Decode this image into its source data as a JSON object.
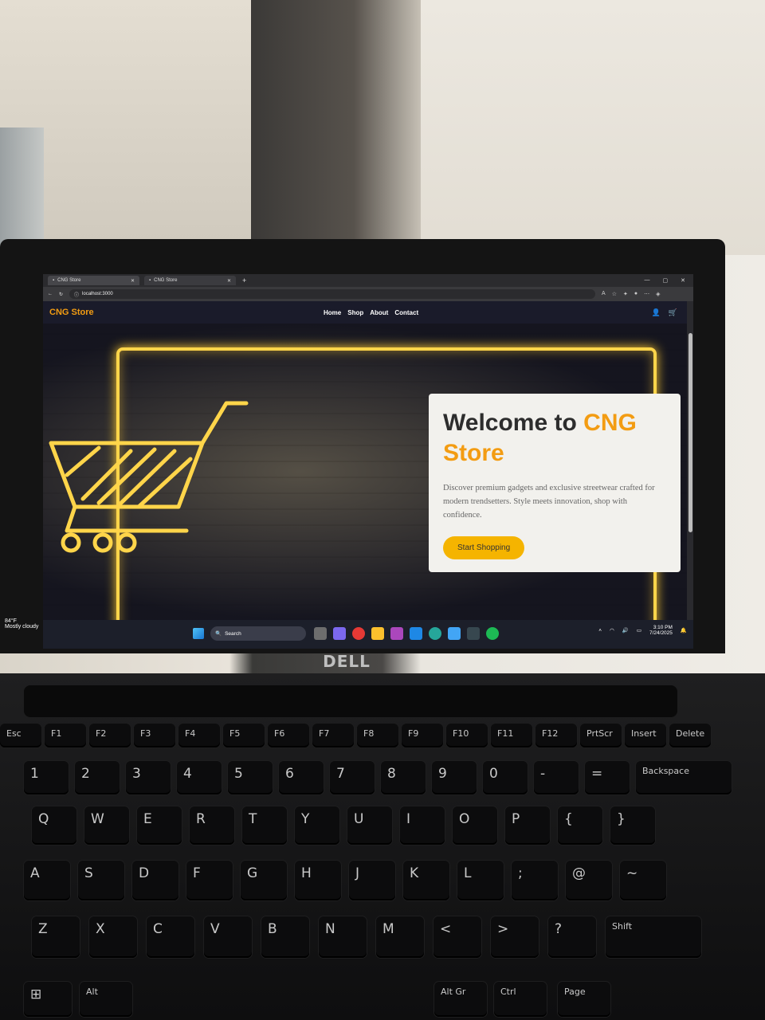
{
  "browser": {
    "tabs": [
      {
        "label": "CNG Store",
        "close": "✕"
      },
      {
        "label": "CNG Store",
        "close": "✕"
      }
    ],
    "new_tab": "+",
    "window_controls": [
      "—",
      "▢",
      "✕"
    ],
    "url": "localhost:3000"
  },
  "site": {
    "brand": "CNG Store",
    "nav": [
      "Home",
      "Shop",
      "About",
      "Contact"
    ],
    "hero": {
      "title_part1": "Welcome to ",
      "title_accent": "CNG",
      "title_part2": "Store",
      "description": "Discover premium gadgets and exclusive streetwear crafted for modern trendsetters. Style meets innovation, shop with confidence.",
      "cta": "Start Shopping"
    },
    "accent_color": "#f39c12",
    "button_color": "#f5b400"
  },
  "taskbar": {
    "weather_temp": "84°F",
    "weather_desc": "Mostly cloudy",
    "search_placeholder": "Search",
    "time": "3:10 PM",
    "date": "7/24/2025"
  },
  "laptop": {
    "brand": "DELL",
    "keys_f": [
      "Esc",
      "F1",
      "F2",
      "F3",
      "F4",
      "F5",
      "F6",
      "F7",
      "F8",
      "F9",
      "F10",
      "F11",
      "F12",
      "PrtScr",
      "Insert",
      "Delete"
    ],
    "keys_num": [
      "1",
      "2",
      "3",
      "4",
      "5",
      "6",
      "7",
      "8",
      "9",
      "0",
      "-",
      "=",
      "Backspace"
    ],
    "keys_qwerty": [
      "Q",
      "W",
      "E",
      "R",
      "T",
      "Y",
      "U",
      "I",
      "O",
      "P",
      "{",
      "}"
    ],
    "keys_asdf": [
      "A",
      "S",
      "D",
      "F",
      "G",
      "H",
      "J",
      "K",
      "L",
      ";",
      "@",
      "~"
    ],
    "keys_zxcv": [
      "Z",
      "X",
      "C",
      "V",
      "B",
      "N",
      "M",
      "<",
      ">",
      "?",
      "Shift"
    ],
    "keys_bottom": [
      "Alt",
      "Alt Gr",
      "Ctrl",
      "Page"
    ]
  }
}
